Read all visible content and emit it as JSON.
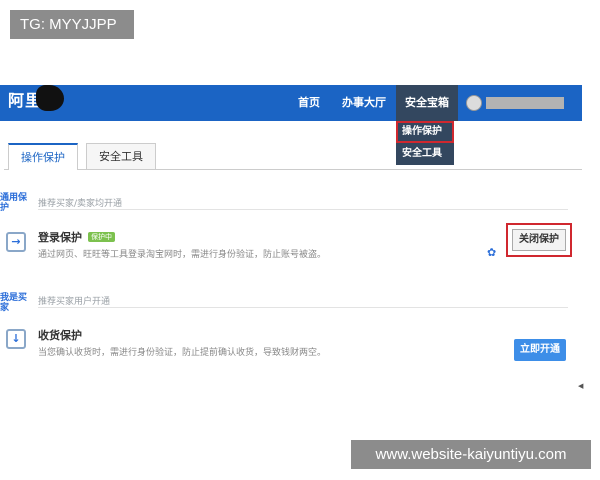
{
  "watermarks": {
    "top": "TG: MYYJJPP",
    "bottom": "www.website-kaiyuntiyu.com"
  },
  "header": {
    "logo": "阿里",
    "nav": [
      "首页",
      "办事大厅",
      "安全宝箱"
    ],
    "dropdown": [
      "操作保护",
      "安全工具"
    ]
  },
  "tabs": [
    "操作保护",
    "安全工具"
  ],
  "sections": [
    {
      "label": "通用保护",
      "hint": "推荐买家/卖家均开通",
      "item": {
        "title": "登录保护",
        "badge": "保护中",
        "desc": "通过网页、旺旺等工具登录淘宝网时，需进行身份验证，防止账号被盗。",
        "action": "关闭保护"
      }
    },
    {
      "label": "我是买家",
      "hint": "推荐买家用户开通",
      "item": {
        "title": "收货保护",
        "desc": "当您确认收货时，需进行身份验证，防止提前确认收货，导致钱财两空。",
        "action": "立即开通"
      }
    }
  ],
  "colors": {
    "header_blue": "#1b64c4",
    "menu_dark": "#33475f",
    "highlight_red": "#d0282f",
    "badge_green": "#7cc14e",
    "button_blue": "#3d8ee8"
  },
  "icons": [
    "user-avatar-icon",
    "login-arrow-icon",
    "gear-icon",
    "download-arrow-icon"
  ]
}
